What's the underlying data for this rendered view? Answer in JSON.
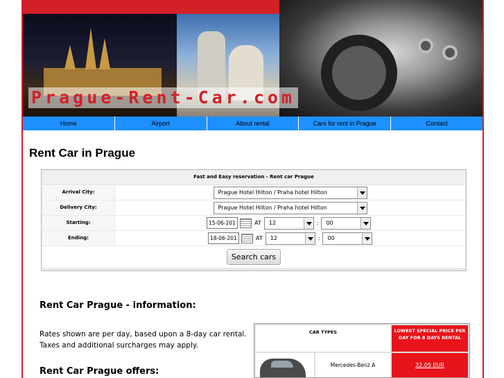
{
  "header": {
    "logo_text": "Prague-Rent-Car.com"
  },
  "nav": {
    "items": [
      {
        "label": "Home"
      },
      {
        "label": "Airport"
      },
      {
        "label": "About rental"
      },
      {
        "label": "Cars for rent in Prague"
      },
      {
        "label": "Contact"
      }
    ]
  },
  "main": {
    "title": "Rent Car in Prague"
  },
  "reservation": {
    "caption": "Fast and Easy reservation - Rent car Prague",
    "arrival_label": "Arrival City:",
    "arrival_value": "Prague Hotel Hilton / Praha hotel Hilton",
    "delivery_label": "Delivery City:",
    "delivery_value": "Prague Hotel Hilton / Praha hotel Hilton",
    "starting_label": "Starting:",
    "starting_date": "15-06-201",
    "starting_hour": "12",
    "starting_min": "00",
    "ending_label": "Ending:",
    "ending_date": "18-06-201",
    "ending_hour": "12",
    "ending_min": "00",
    "at_label": "AT",
    "colon": ":",
    "submit_label": "Search cars"
  },
  "info": {
    "heading": "Rent Car Prague - information:",
    "text_line1": "Rates shown are per day, based upon a 8-day car rental.",
    "text_line2": "Taxes and additional surcharges may apply.",
    "offers_heading": "Rent Car Prague offers:"
  },
  "car_table": {
    "types_header": "CAR TYPES",
    "price_header": "LOWEST SPECIAL PRICE PER DAY FOR 8 DAYS RENTAL",
    "rows": [
      {
        "name": "Mercedes-Benz A",
        "price": "32.05 EUR"
      }
    ]
  },
  "colors": {
    "accent_red": "#d32027",
    "nav_blue": "#1e90ff",
    "price_red": "#e8141c"
  }
}
